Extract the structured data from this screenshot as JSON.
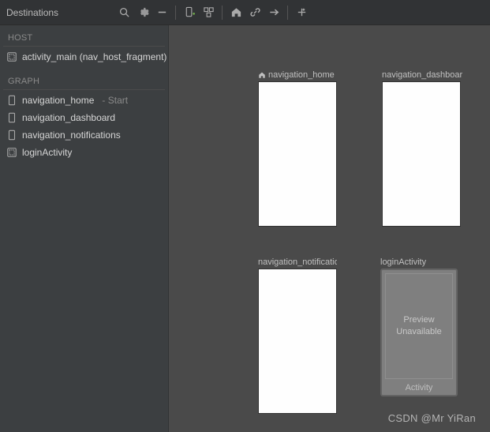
{
  "panel_title": "Destinations",
  "toolbar": {
    "search": "search-icon",
    "settings": "gear-icon",
    "remove": "minus-icon",
    "add_destination": "add-destination-icon",
    "nest_graph": "nest-graph-icon",
    "home": "home-icon",
    "deep_link": "link-icon",
    "action": "arrow-right-icon",
    "auto_arrange": "auto-arrange-icon"
  },
  "sections": {
    "host_header": "HOST",
    "graph_header": "GRAPH"
  },
  "host": {
    "label": "activity_main (nav_host_fragment)"
  },
  "graph": [
    {
      "label": "navigation_home",
      "suffix": "- Start"
    },
    {
      "label": "navigation_dashboard",
      "suffix": ""
    },
    {
      "label": "navigation_notifications",
      "suffix": ""
    },
    {
      "label": "loginActivity",
      "suffix": ""
    }
  ],
  "canvas": {
    "nodes": [
      {
        "name": "navigation_home",
        "is_start": true
      },
      {
        "name": "navigation_dashboard",
        "is_start": false
      },
      {
        "name": "navigation_notificatio...",
        "is_start": false
      },
      {
        "name": "loginActivity",
        "is_start": false
      }
    ],
    "preview_unavailable_line1": "Preview",
    "preview_unavailable_line2": "Unavailable",
    "activity_tag": "Activity"
  },
  "watermark": "CSDN @Mr YiRan"
}
